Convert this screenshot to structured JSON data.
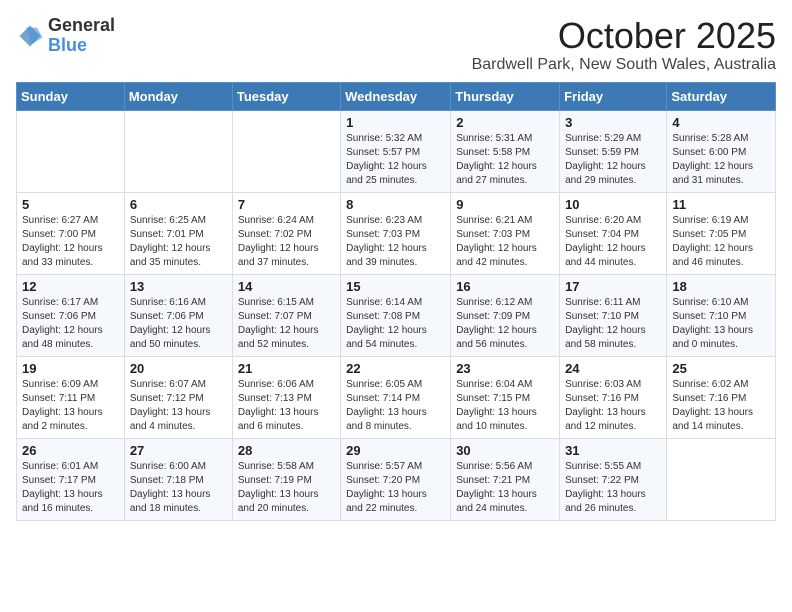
{
  "logo": {
    "general": "General",
    "blue": "Blue"
  },
  "title": "October 2025",
  "location": "Bardwell Park, New South Wales, Australia",
  "days_of_week": [
    "Sunday",
    "Monday",
    "Tuesday",
    "Wednesday",
    "Thursday",
    "Friday",
    "Saturday"
  ],
  "weeks": [
    [
      {
        "day": "",
        "info": ""
      },
      {
        "day": "",
        "info": ""
      },
      {
        "day": "",
        "info": ""
      },
      {
        "day": "1",
        "info": "Sunrise: 5:32 AM\nSunset: 5:57 PM\nDaylight: 12 hours\nand 25 minutes."
      },
      {
        "day": "2",
        "info": "Sunrise: 5:31 AM\nSunset: 5:58 PM\nDaylight: 12 hours\nand 27 minutes."
      },
      {
        "day": "3",
        "info": "Sunrise: 5:29 AM\nSunset: 5:59 PM\nDaylight: 12 hours\nand 29 minutes."
      },
      {
        "day": "4",
        "info": "Sunrise: 5:28 AM\nSunset: 6:00 PM\nDaylight: 12 hours\nand 31 minutes."
      }
    ],
    [
      {
        "day": "5",
        "info": "Sunrise: 6:27 AM\nSunset: 7:00 PM\nDaylight: 12 hours\nand 33 minutes."
      },
      {
        "day": "6",
        "info": "Sunrise: 6:25 AM\nSunset: 7:01 PM\nDaylight: 12 hours\nand 35 minutes."
      },
      {
        "day": "7",
        "info": "Sunrise: 6:24 AM\nSunset: 7:02 PM\nDaylight: 12 hours\nand 37 minutes."
      },
      {
        "day": "8",
        "info": "Sunrise: 6:23 AM\nSunset: 7:03 PM\nDaylight: 12 hours\nand 39 minutes."
      },
      {
        "day": "9",
        "info": "Sunrise: 6:21 AM\nSunset: 7:03 PM\nDaylight: 12 hours\nand 42 minutes."
      },
      {
        "day": "10",
        "info": "Sunrise: 6:20 AM\nSunset: 7:04 PM\nDaylight: 12 hours\nand 44 minutes."
      },
      {
        "day": "11",
        "info": "Sunrise: 6:19 AM\nSunset: 7:05 PM\nDaylight: 12 hours\nand 46 minutes."
      }
    ],
    [
      {
        "day": "12",
        "info": "Sunrise: 6:17 AM\nSunset: 7:06 PM\nDaylight: 12 hours\nand 48 minutes."
      },
      {
        "day": "13",
        "info": "Sunrise: 6:16 AM\nSunset: 7:06 PM\nDaylight: 12 hours\nand 50 minutes."
      },
      {
        "day": "14",
        "info": "Sunrise: 6:15 AM\nSunset: 7:07 PM\nDaylight: 12 hours\nand 52 minutes."
      },
      {
        "day": "15",
        "info": "Sunrise: 6:14 AM\nSunset: 7:08 PM\nDaylight: 12 hours\nand 54 minutes."
      },
      {
        "day": "16",
        "info": "Sunrise: 6:12 AM\nSunset: 7:09 PM\nDaylight: 12 hours\nand 56 minutes."
      },
      {
        "day": "17",
        "info": "Sunrise: 6:11 AM\nSunset: 7:10 PM\nDaylight: 12 hours\nand 58 minutes."
      },
      {
        "day": "18",
        "info": "Sunrise: 6:10 AM\nSunset: 7:10 PM\nDaylight: 13 hours\nand 0 minutes."
      }
    ],
    [
      {
        "day": "19",
        "info": "Sunrise: 6:09 AM\nSunset: 7:11 PM\nDaylight: 13 hours\nand 2 minutes."
      },
      {
        "day": "20",
        "info": "Sunrise: 6:07 AM\nSunset: 7:12 PM\nDaylight: 13 hours\nand 4 minutes."
      },
      {
        "day": "21",
        "info": "Sunrise: 6:06 AM\nSunset: 7:13 PM\nDaylight: 13 hours\nand 6 minutes."
      },
      {
        "day": "22",
        "info": "Sunrise: 6:05 AM\nSunset: 7:14 PM\nDaylight: 13 hours\nand 8 minutes."
      },
      {
        "day": "23",
        "info": "Sunrise: 6:04 AM\nSunset: 7:15 PM\nDaylight: 13 hours\nand 10 minutes."
      },
      {
        "day": "24",
        "info": "Sunrise: 6:03 AM\nSunset: 7:16 PM\nDaylight: 13 hours\nand 12 minutes."
      },
      {
        "day": "25",
        "info": "Sunrise: 6:02 AM\nSunset: 7:16 PM\nDaylight: 13 hours\nand 14 minutes."
      }
    ],
    [
      {
        "day": "26",
        "info": "Sunrise: 6:01 AM\nSunset: 7:17 PM\nDaylight: 13 hours\nand 16 minutes."
      },
      {
        "day": "27",
        "info": "Sunrise: 6:00 AM\nSunset: 7:18 PM\nDaylight: 13 hours\nand 18 minutes."
      },
      {
        "day": "28",
        "info": "Sunrise: 5:58 AM\nSunset: 7:19 PM\nDaylight: 13 hours\nand 20 minutes."
      },
      {
        "day": "29",
        "info": "Sunrise: 5:57 AM\nSunset: 7:20 PM\nDaylight: 13 hours\nand 22 minutes."
      },
      {
        "day": "30",
        "info": "Sunrise: 5:56 AM\nSunset: 7:21 PM\nDaylight: 13 hours\nand 24 minutes."
      },
      {
        "day": "31",
        "info": "Sunrise: 5:55 AM\nSunset: 7:22 PM\nDaylight: 13 hours\nand 26 minutes."
      },
      {
        "day": "",
        "info": ""
      }
    ]
  ]
}
